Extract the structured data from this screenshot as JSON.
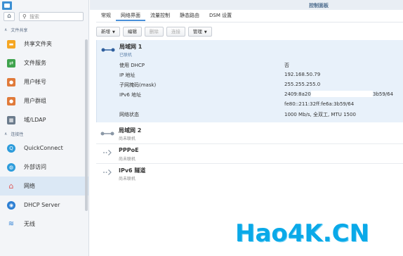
{
  "window": {
    "title": "控制面板"
  },
  "search": {
    "placeholder": "搜索"
  },
  "sidebar": {
    "section_sharing": "文件共享",
    "section_connectivity": "连接性",
    "items": [
      {
        "label": "共享文件夹",
        "icon": "folder-icon",
        "color": "#f5a623"
      },
      {
        "label": "文件服务",
        "icon": "file-services-icon",
        "color": "#3fa34d"
      },
      {
        "label": "用户帐号",
        "icon": "user-icon",
        "color": "#e07a3a"
      },
      {
        "label": "用户群组",
        "icon": "group-icon",
        "color": "#e07a3a"
      },
      {
        "label": "域/LDAP",
        "icon": "ldap-icon",
        "color": "#6b7b8c"
      },
      {
        "label": "QuickConnect",
        "icon": "quickconnect-icon",
        "color": "#2d9cdb"
      },
      {
        "label": "外部访问",
        "icon": "globe-icon",
        "color": "#2d9cdb"
      },
      {
        "label": "网络",
        "icon": "network-house-icon",
        "color": "#e05a5a"
      },
      {
        "label": "DHCP Server",
        "icon": "dhcp-icon",
        "color": "#2d7fd3"
      },
      {
        "label": "无线",
        "icon": "wifi-icon",
        "color": "#2d7fd3"
      }
    ]
  },
  "tabs": [
    {
      "label": "常规"
    },
    {
      "label": "网络界面"
    },
    {
      "label": "流量控制"
    },
    {
      "label": "静态路由"
    },
    {
      "label": "DSM 设置"
    }
  ],
  "toolbar": {
    "create_label": "新增",
    "edit_label": "编辑",
    "delete_label": "删除",
    "connect_label": "连接",
    "manage_label": "管理"
  },
  "interfaces": [
    {
      "name": "局域网 1",
      "status": "已联机",
      "details": [
        {
          "label": "使用 DHCP",
          "value": "否"
        },
        {
          "label": "IP 地址",
          "value": "192.168.50.79"
        },
        {
          "label": "子网掩码(mask)",
          "value": "255.255.255.0"
        },
        {
          "label": "IPv6 地址",
          "value": "2409:8a20:",
          "value_tail": "3b59/64"
        },
        {
          "label": "",
          "value": "fe80::211:32ff:fe6a:3b59/64"
        },
        {
          "label": "网络状态",
          "value": "1000 Mb/s, 全双工, MTU 1500"
        }
      ]
    },
    {
      "name": "局域网 2",
      "status": "尚未联机"
    },
    {
      "name": "PPPoE",
      "status": "尚未联机"
    },
    {
      "name": "IPv6 隧道",
      "status": "尚未联机"
    }
  ],
  "watermark": {
    "text": "Hao4K.CN"
  }
}
